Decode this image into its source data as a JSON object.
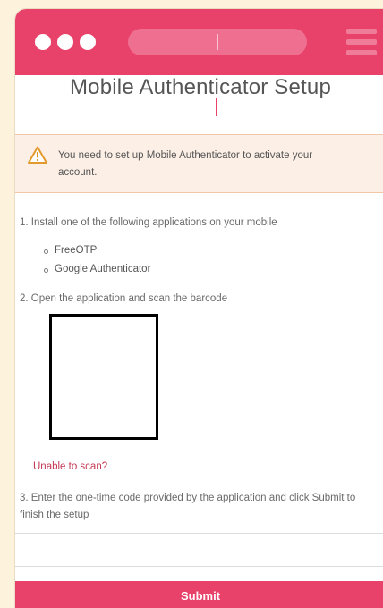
{
  "colors": {
    "accent": "#e8416a",
    "background": "#fdf3dd",
    "alert_bg": "#fcefe6",
    "link": "#c43652"
  },
  "browser": {
    "url": "",
    "menu_icon": "hamburger-menu-icon"
  },
  "page": {
    "title": "Mobile Authenticator Setup"
  },
  "alert": {
    "icon": "warning-icon",
    "message": "You need to set up Mobile Authenticator to activate your account."
  },
  "steps": {
    "step1": "1. Install one of the following applications on your mobile",
    "apps": [
      "FreeOTP",
      "Google Authenticator"
    ],
    "step2": "2. Open the application and scan the barcode",
    "unable_to_scan": "Unable to scan?",
    "step3": "3. Enter the one-time code provided by the application and click Submit to finish the setup"
  },
  "form": {
    "code_value": "",
    "submit_label": "Submit"
  }
}
